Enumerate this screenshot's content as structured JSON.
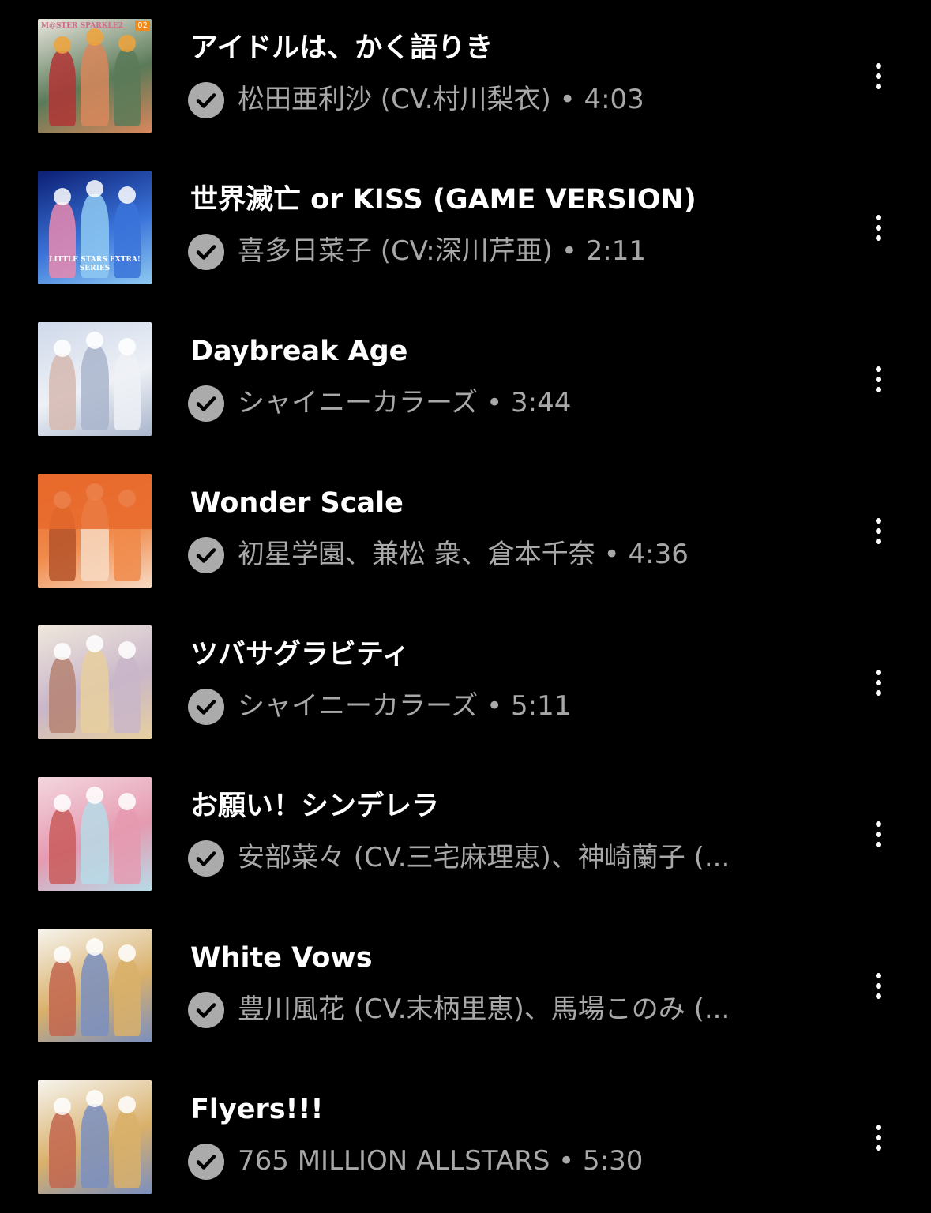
{
  "tracks": [
    {
      "title": "アイドルは、かく語りき",
      "artist": "松田亜利沙 (CV.村川梨衣)",
      "duration": "4:03",
      "downloaded": true,
      "art": {
        "label": "M@STER SPARKLE2",
        "badge": "02",
        "colors": [
          "#e9e6de",
          "#5a7a58",
          "#d9875c",
          "#b03535",
          "#f0a33a"
        ]
      }
    },
    {
      "title": "世界滅亡 or KISS (GAME VERSION)",
      "artist": "喜多日菜子 (CV:深川芹亜)",
      "duration": "2:11",
      "downloaded": true,
      "art": {
        "label": "LITTLE STARS EXTRA! SERIES",
        "colors": [
          "#0b1e73",
          "#3a73d9",
          "#8ec9f2",
          "#e88ab0",
          "#ffffff"
        ]
      }
    },
    {
      "title": "Daybreak Age",
      "artist": "シャイニーカラーズ",
      "duration": "3:44",
      "downloaded": true,
      "art": {
        "colors": [
          "#cfd9ea",
          "#eef1f6",
          "#a9b5cc",
          "#d6b9b0",
          "#ffffff"
        ]
      }
    },
    {
      "title": "Wonder Scale",
      "artist": "初星学園、兼松 衆、倉本千奈",
      "duration": "4:36",
      "downloaded": true,
      "art": {
        "colors": [
          "#e86a2c",
          "#f08a4a",
          "#f7d9c2",
          "#b5542a",
          "#ffffff"
        ]
      }
    },
    {
      "title": "ツバサグラビティ",
      "artist": "シャイニーカラーズ",
      "duration": "5:11",
      "downloaded": true,
      "art": {
        "colors": [
          "#efe7dc",
          "#c9b6c9",
          "#e7cf9f",
          "#b58273",
          "#ffffff"
        ]
      }
    },
    {
      "title": "お願い！シンデレラ",
      "artist": "安部菜々 (CV.三宅麻理恵)、神崎蘭子 (...",
      "duration": "",
      "downloaded": true,
      "art": {
        "colors": [
          "#f3d6de",
          "#e59ab0",
          "#b7dbe8",
          "#c95c5c",
          "#ffffff"
        ]
      }
    },
    {
      "title": "White Vows",
      "artist": "豊川風花 (CV.末柄里恵)、馬場このみ (...",
      "duration": "",
      "downloaded": true,
      "art": {
        "colors": [
          "#f6f4ee",
          "#d9b06a",
          "#7a8fbf",
          "#c2664f",
          "#ffffff"
        ]
      }
    },
    {
      "title": "Flyers!!!",
      "artist": "765 MILLION ALLSTARS",
      "duration": "5:30",
      "downloaded": true,
      "art": {
        "colors": [
          "#f6f4ee",
          "#d9b06a",
          "#7a8fbf",
          "#c2664f",
          "#ffffff"
        ]
      }
    }
  ],
  "separator": "•",
  "icons": {
    "downloaded": "check-circle-icon",
    "more": "more-vertical-icon"
  },
  "theme": {
    "background": "#000000",
    "title_color": "#ffffff",
    "subtitle_color": "#a8a8a8",
    "badge_color": "#ababab"
  }
}
